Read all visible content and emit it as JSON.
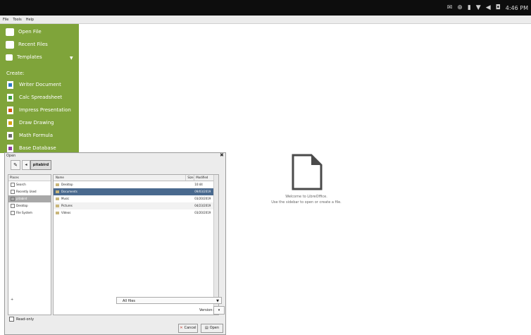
{
  "topbar": {
    "icons": [
      "mail-icon",
      "settings-icon",
      "battery-icon",
      "network-icon",
      "volume-icon",
      "display-icon"
    ],
    "clock": "4:46 PM"
  },
  "menubar": {
    "items": [
      "File",
      "Tools",
      "Help"
    ]
  },
  "sidebar": {
    "open_file": "Open File",
    "recent_files": "Recent Files",
    "templates": "Templates",
    "create_label": "Create:",
    "items": [
      {
        "label": "Writer Document",
        "color": "#2b79c6"
      },
      {
        "label": "Calc Spreadsheet",
        "color": "#3d9b3d"
      },
      {
        "label": "Impress Presentation",
        "color": "#d4570d"
      },
      {
        "label": "Draw Drawing",
        "color": "#d8a40e"
      },
      {
        "label": "Math Formula",
        "color": "#6b6b6b"
      },
      {
        "label": "Base Database",
        "color": "#8c3d9b"
      }
    ],
    "accent": "#7fa43a"
  },
  "welcome": {
    "title": "Welcome to LibreOffice.",
    "subtitle": "Use the sidebar to open or create a file."
  },
  "dialog": {
    "title": "Open",
    "path_button": "pitabird",
    "places_header": "Places",
    "places": [
      "Search",
      "Recently Used",
      "pitabird",
      "Desktop",
      "File System"
    ],
    "places_selected": 2,
    "columns": [
      "Name",
      "Size",
      "Modified"
    ],
    "files": [
      {
        "name": "Desktop",
        "size": "",
        "modified": "10:44"
      },
      {
        "name": "Documents",
        "size": "",
        "modified": "09/03/2019"
      },
      {
        "name": "Music",
        "size": "",
        "modified": "03/20/2019"
      },
      {
        "name": "Pictures",
        "size": "",
        "modified": "04/23/2019"
      },
      {
        "name": "Videos",
        "size": "",
        "modified": "03/20/2019"
      }
    ],
    "files_selected": 1,
    "add_button": "+",
    "filter": "All files",
    "version_label": "Version:",
    "read_only": "Read-only",
    "cancel": "Cancel",
    "open": "Open"
  }
}
